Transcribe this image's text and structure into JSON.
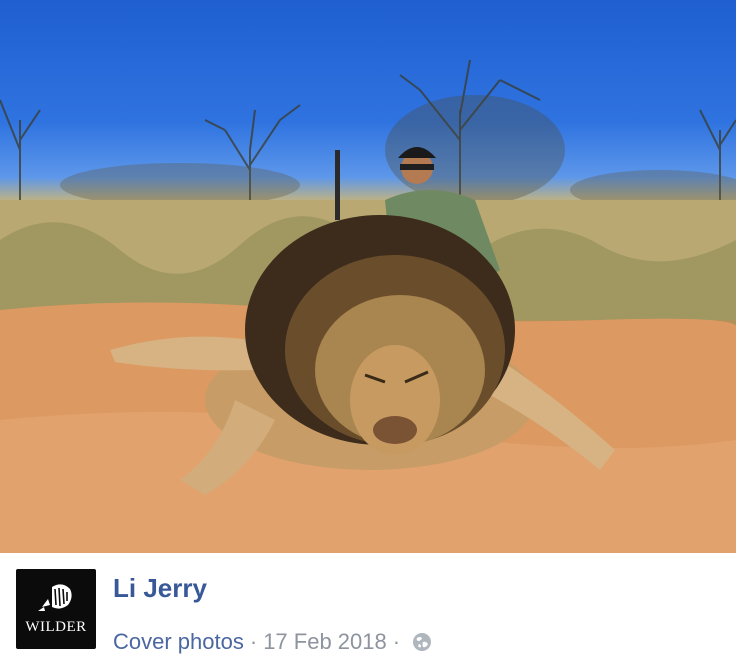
{
  "post": {
    "author_name": "Li Jerry",
    "album_link": "Cover photos",
    "separator_1": "·",
    "date": "17 Feb 2018",
    "separator_2": "·",
    "privacy_icon": "globe-icon"
  },
  "avatar": {
    "brand_text": "WILDER",
    "logo_icon": "rhino-logo-icon",
    "background": "#0b0b0b"
  },
  "colors": {
    "name": "#385898",
    "meta_text": "#8d949e",
    "link": "#4b67a1"
  }
}
